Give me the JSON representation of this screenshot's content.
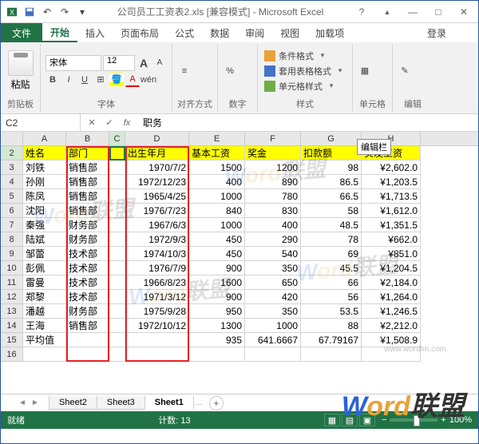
{
  "window": {
    "title": "公司员工工资表2.xls [兼容模式] - Microsoft Excel"
  },
  "qat": [
    "excel-icon",
    "save-icon",
    "undo-icon",
    "redo-icon"
  ],
  "win": {
    "help": "?",
    "up": "▲",
    "min": "—",
    "max": "□",
    "close": "✕"
  },
  "tabs": {
    "file": "文件",
    "home": "开始",
    "insert": "插入",
    "layout": "页面布局",
    "formula": "公式",
    "data": "数据",
    "review": "审阅",
    "view": "视图",
    "addin": "加载项",
    "login": "登录"
  },
  "ribbon": {
    "clipboard": {
      "paste": "粘贴",
      "label": "剪贴板"
    },
    "font": {
      "name": "宋体",
      "size": "12",
      "bold": "B",
      "italic": "I",
      "underline": "U",
      "label": "字体"
    },
    "align": {
      "label": "对齐方式"
    },
    "number": {
      "btn": "%",
      "label": "数字"
    },
    "styles": {
      "cond": "条件格式",
      "table": "套用表格格式",
      "cell": "单元格样式",
      "label": "样式"
    },
    "cells": {
      "label": "单元格"
    },
    "edit": {
      "label": "编辑"
    }
  },
  "namebox": "C2",
  "formula": {
    "fx": "fx",
    "value": "职务",
    "tooltip": "编辑栏"
  },
  "columns": [
    "A",
    "B",
    "C",
    "D",
    "E",
    "F",
    "G",
    "H"
  ],
  "rows": [
    "2",
    "3",
    "4",
    "5",
    "6",
    "7",
    "8",
    "9",
    "10",
    "11",
    "12",
    "13",
    "14",
    "15",
    "16"
  ],
  "headers": {
    "A": "姓名",
    "B": "部门",
    "D": "出生年月",
    "E": "基本工资",
    "F": "奖金",
    "G": "扣款额",
    "H": "实发工资"
  },
  "data": [
    {
      "A": "刘铁",
      "B": "销售部",
      "D": "1970/7/2",
      "E": "1500",
      "F": "1200",
      "G": "98",
      "H": "¥2,602.0"
    },
    {
      "A": "孙刚",
      "B": "销售部",
      "D": "1972/12/23",
      "E": "400",
      "F": "890",
      "G": "86.5",
      "H": "¥1,203.5"
    },
    {
      "A": "陈凤",
      "B": "销售部",
      "D": "1965/4/25",
      "E": "1000",
      "F": "780",
      "G": "66.5",
      "H": "¥1,713.5"
    },
    {
      "A": "沈阳",
      "B": "销售部",
      "D": "1976/7/23",
      "E": "840",
      "F": "830",
      "G": "58",
      "H": "¥1,612.0"
    },
    {
      "A": "秦强",
      "B": "财务部",
      "D": "1967/6/3",
      "E": "1000",
      "F": "400",
      "G": "48.5",
      "H": "¥1,351.5"
    },
    {
      "A": "陆斌",
      "B": "财务部",
      "D": "1972/9/3",
      "E": "450",
      "F": "290",
      "G": "78",
      "H": "¥662.0"
    },
    {
      "A": "邹蕾",
      "B": "技术部",
      "D": "1974/10/3",
      "E": "450",
      "F": "540",
      "G": "69",
      "H": "¥851.0"
    },
    {
      "A": "彭佩",
      "B": "技术部",
      "D": "1976/7/9",
      "E": "900",
      "F": "350",
      "G": "45.5",
      "H": "¥1,204.5"
    },
    {
      "A": "雷曼",
      "B": "技术部",
      "D": "1966/8/23",
      "E": "1600",
      "F": "650",
      "G": "66",
      "H": "¥2,184.0"
    },
    {
      "A": "郑黎",
      "B": "技术部",
      "D": "1971/3/12",
      "E": "900",
      "F": "420",
      "G": "56",
      "H": "¥1,264.0"
    },
    {
      "A": "潘越",
      "B": "财务部",
      "D": "1975/9/28",
      "E": "950",
      "F": "350",
      "G": "53.5",
      "H": "¥1,246.5"
    },
    {
      "A": "王海",
      "B": "销售部",
      "D": "1972/10/12",
      "E": "1300",
      "F": "1000",
      "G": "88",
      "H": "¥2,212.0"
    },
    {
      "A": "平均值",
      "B": "",
      "D": "",
      "E": "935",
      "F": "641.6667",
      "G": "67.79167",
      "H": "¥1,508.9"
    }
  ],
  "sheets": {
    "nav": [
      "◄",
      "►"
    ],
    "tabs": [
      "Sheet2",
      "Sheet3",
      "Sheet1"
    ],
    "active": 2,
    "add": "+",
    "more": "…"
  },
  "status": {
    "ready": "就绪",
    "stats": "计数: 13",
    "zoom": "100%"
  },
  "watermark": {
    "t1": "W",
    "t2": "ord",
    "t3": "联盟",
    "url": "www.wordlm.com"
  }
}
